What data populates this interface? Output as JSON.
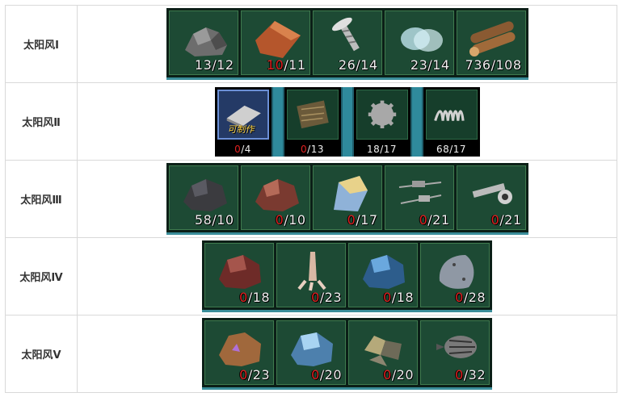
{
  "tiers": [
    {
      "label": "太阳风Ⅰ",
      "style": "green",
      "items": [
        {
          "icon": "rock-pile-icon",
          "have": "13",
          "need": "12",
          "short": false
        },
        {
          "icon": "leather-hide-icon",
          "have": "10",
          "need": "11",
          "short": true
        },
        {
          "icon": "screw-icon",
          "have": "26",
          "need": "14",
          "short": false
        },
        {
          "icon": "glass-lens-icon",
          "have": "23",
          "need": "14",
          "short": false
        },
        {
          "icon": "wood-logs-icon",
          "have": "736",
          "need": "108",
          "short": false
        }
      ]
    },
    {
      "label": "太阳风Ⅱ",
      "style": "dark",
      "items": [
        {
          "icon": "metal-plate-icon",
          "have": "0",
          "need": "4",
          "short": true,
          "tag": "可制作",
          "highlight": true
        },
        {
          "icon": "scrap-bundle-icon",
          "have": "0",
          "need": "13",
          "short": true
        },
        {
          "icon": "gear-icon",
          "have": "18",
          "need": "17",
          "short": false
        },
        {
          "icon": "spring-coil-icon",
          "have": "68",
          "need": "17",
          "short": false
        }
      ]
    },
    {
      "label": "太阳风Ⅲ",
      "style": "green",
      "items": [
        {
          "icon": "dark-ore-icon",
          "have": "58",
          "need": "10",
          "short": false
        },
        {
          "icon": "copper-ore-icon",
          "have": "0",
          "need": "10",
          "short": true
        },
        {
          "icon": "crystal-shard-icon",
          "have": "0",
          "need": "17",
          "short": true
        },
        {
          "icon": "resistor-parts-icon",
          "have": "0",
          "need": "21",
          "short": true
        },
        {
          "icon": "wrench-parts-icon",
          "have": "0",
          "need": "21",
          "short": true
        }
      ]
    },
    {
      "label": "太阳风Ⅳ",
      "style": "green",
      "items": [
        {
          "icon": "red-ore-icon",
          "have": "0",
          "need": "18",
          "short": true
        },
        {
          "icon": "claw-icon",
          "have": "0",
          "need": "23",
          "short": true
        },
        {
          "icon": "blue-ore-icon",
          "have": "0",
          "need": "18",
          "short": true
        },
        {
          "icon": "armor-plate-icon",
          "have": "0",
          "need": "28",
          "short": true
        }
      ]
    },
    {
      "label": "太阳风Ⅴ",
      "style": "green",
      "items": [
        {
          "icon": "purple-crystal-ore-icon",
          "have": "0",
          "need": "23",
          "short": true
        },
        {
          "icon": "ice-ore-icon",
          "have": "0",
          "need": "20",
          "short": true
        },
        {
          "icon": "pyrite-icon",
          "have": "0",
          "need": "20",
          "short": true
        },
        {
          "icon": "drill-bit-icon",
          "have": "0",
          "need": "32",
          "short": true
        }
      ]
    }
  ],
  "colors": {
    "slot_bg": "#1d4a34",
    "shortage": "#e02020",
    "count": "#f0f0f0",
    "accent_bar": "#3a8d9a",
    "craft_tag": "#ffd23c"
  }
}
